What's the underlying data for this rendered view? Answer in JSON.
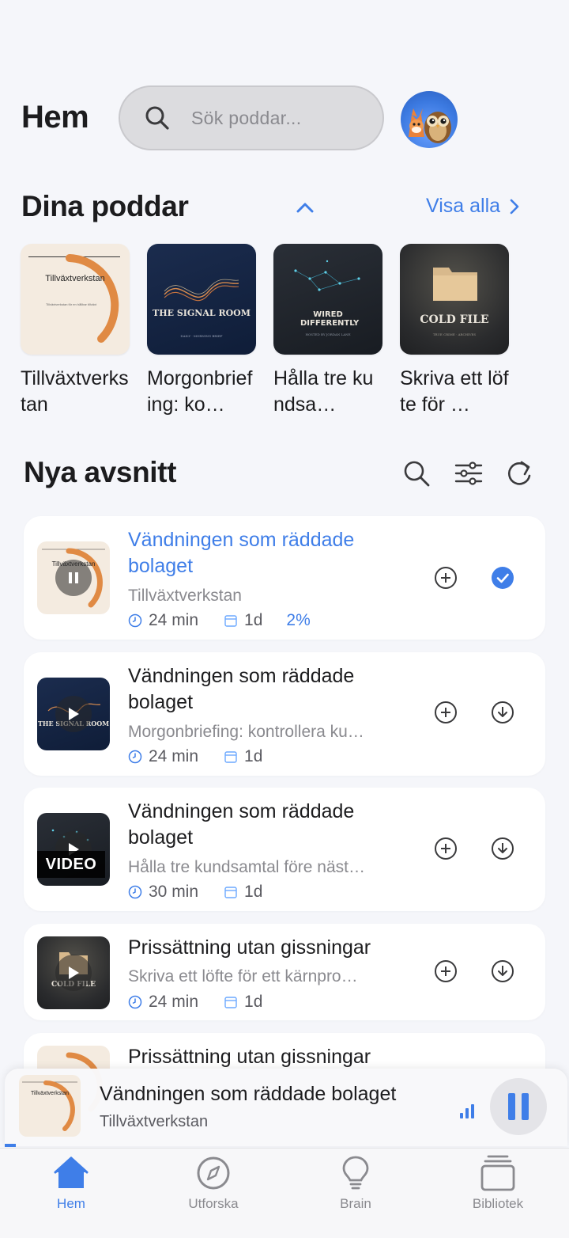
{
  "header": {
    "title": "Hem",
    "search_placeholder": "Sök poddar..."
  },
  "your_podcasts": {
    "title": "Dina poddar",
    "see_all": "Visa alla",
    "items": [
      {
        "title": "Tillväxtverkstan",
        "cover_text": "Tillväxtverkstan",
        "cover_sub": "Tillväxtverkstan för en hållbar tillväxt"
      },
      {
        "title": "Morgonbriefing: ko…",
        "cover_text": "THE SIGNAL ROOM",
        "cover_sub": "DAILY · MORNING BRIEF"
      },
      {
        "title": "Hålla tre kundsa…",
        "cover_text": "WIRED DIFFERENTLY",
        "cover_sub": "HOSTED BY JORDAN LANE"
      },
      {
        "title": "Skriva ett löfte för …",
        "cover_text": "COLD FILE",
        "cover_sub": "TRUE CRIME · ARCHIVES"
      }
    ]
  },
  "new_episodes": {
    "title": "Nya avsnitt",
    "items": [
      {
        "title": "Vändningen som räddade bolaget",
        "podcast": "Tillväxtverkstan",
        "duration": "24 min",
        "age": "1d",
        "progress": "2%",
        "active": true,
        "status": "downloaded"
      },
      {
        "title": "Vändningen som räddade bolaget",
        "podcast": "Morgonbriefing: kontrollera ku…",
        "duration": "24 min",
        "age": "1d",
        "status": "download"
      },
      {
        "title": "Vändningen som räddade bolaget",
        "podcast": "Hålla tre kundsamtal före näst…",
        "duration": "30 min",
        "age": "1d",
        "status": "download",
        "badge": "VIDEO"
      },
      {
        "title": "Prissättning utan gissningar",
        "podcast": "Skriva ett löfte för ett kärnpro…",
        "duration": "24 min",
        "age": "1d",
        "status": "download"
      },
      {
        "title": "Prissättning utan gissningar"
      }
    ]
  },
  "now_playing": {
    "title": "Vändningen som räddade bolaget",
    "podcast": "Tillväxtverkstan",
    "progress_fraction": 0.02
  },
  "tabs": [
    {
      "label": "Hem",
      "icon": "home-icon",
      "active": true
    },
    {
      "label": "Utforska",
      "icon": "compass-icon"
    },
    {
      "label": "Brain",
      "icon": "lightbulb-icon"
    },
    {
      "label": "Bibliotek",
      "icon": "library-icon"
    }
  ],
  "colors": {
    "accent": "#3f7ee8",
    "background": "#f5f6fa",
    "card": "#ffffff"
  }
}
